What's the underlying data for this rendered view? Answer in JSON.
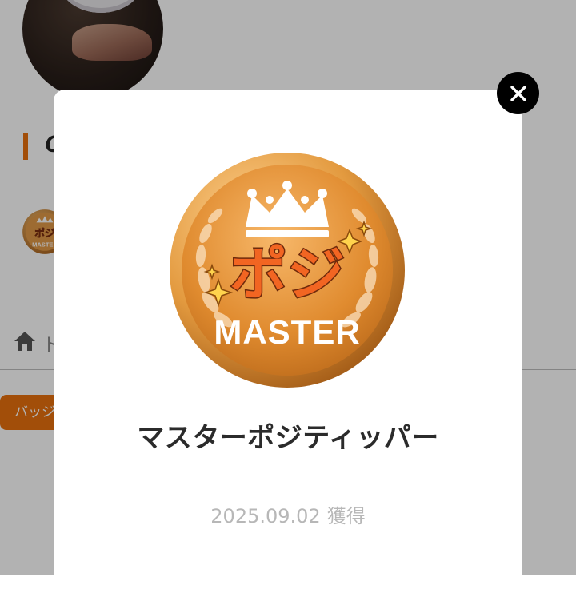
{
  "background": {
    "heading_partial": "C",
    "breadcrumb_partial": "ト",
    "tag_label": "バッジ",
    "accent_color": "#e8700e"
  },
  "modal": {
    "badge": {
      "logo_text": "ポジ",
      "logo_subtext": "MASTER",
      "title": "マスターポジティッパー",
      "acquired_date": "2025.09.02",
      "acquired_label": "獲得"
    },
    "close_icon": "close-icon"
  },
  "icons": [
    "home-icon",
    "close-icon",
    "crown-icon",
    "sparkle-icon"
  ]
}
